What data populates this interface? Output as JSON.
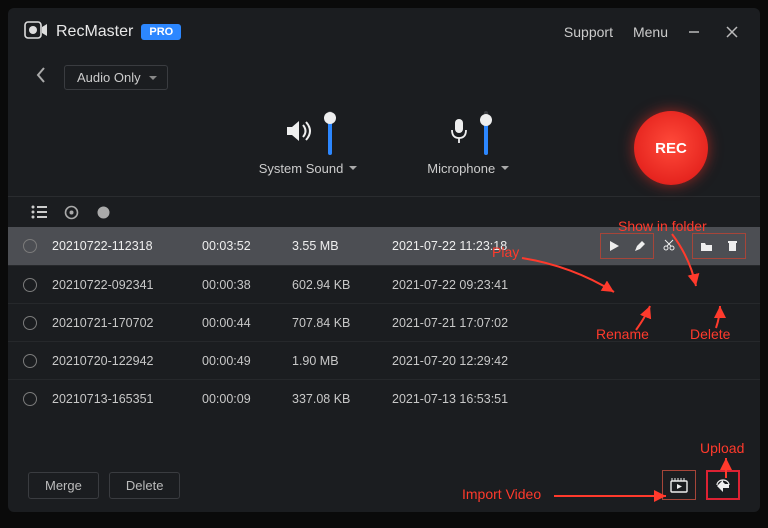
{
  "app": {
    "title": "RecMaster",
    "badge": "PRO"
  },
  "titlebar": {
    "support": "Support",
    "menu": "Menu"
  },
  "mode": {
    "label": "Audio Only"
  },
  "controls": {
    "system_sound": {
      "label": "System Sound",
      "volume_pct": 85
    },
    "microphone": {
      "label": "Microphone",
      "volume_pct": 80
    },
    "rec_label": "REC"
  },
  "files": [
    {
      "name": "20210722-112318",
      "duration": "00:03:52",
      "size": "3.55 MB",
      "date": "2021-07-22 11:23:18",
      "selected": true
    },
    {
      "name": "20210722-092341",
      "duration": "00:00:38",
      "size": "602.94 KB",
      "date": "2021-07-22 09:23:41",
      "selected": false
    },
    {
      "name": "20210721-170702",
      "duration": "00:00:44",
      "size": "707.84 KB",
      "date": "2021-07-21 17:07:02",
      "selected": false
    },
    {
      "name": "20210720-122942",
      "duration": "00:00:49",
      "size": "1.90 MB",
      "date": "2021-07-20 12:29:42",
      "selected": false
    },
    {
      "name": "20210713-165351",
      "duration": "00:00:09",
      "size": "337.08 KB",
      "date": "2021-07-13 16:53:51",
      "selected": false
    }
  ],
  "footer": {
    "merge": "Merge",
    "delete": "Delete"
  },
  "annotations": {
    "play": "Play",
    "show_in_folder": "Show in folder",
    "rename": "Rename",
    "delete": "Delete",
    "import_video": "Import Video",
    "upload": "Upload"
  }
}
